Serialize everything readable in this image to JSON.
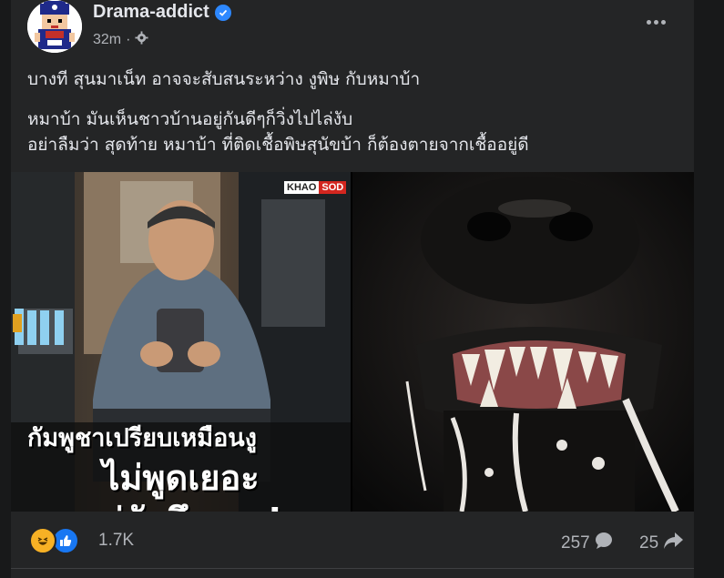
{
  "post": {
    "author": "Drama-addict",
    "time": "32m",
    "text_line1": "บางที สุนมาเน็ท อาจจะสับสนระหว่าง งูพิษ กับหมาบ้า",
    "text_line2": "หมาบ้า มันเห็นชาวบ้านอยู่กันดีๆก็วิ่งไปไล่งับ",
    "text_line3": "อย่าลืมว่า สุดท้าย หมาบ้า ที่ติดเชื้อพิษสุนัขบ้า ก็ต้องตายจากเชื้ออยู่ดี"
  },
  "image": {
    "watermark_a": "KHAO",
    "watermark_b": "SOD",
    "caption_line1": "กัมพูชาเปรียบเหมือนงู",
    "caption_line2": "ไม่พูดเยอะ",
    "caption_line3": "แต่กัดถึงตาย!"
  },
  "stats": {
    "reaction_count": "1.7K",
    "comment_count": "257",
    "share_count": "25"
  },
  "icons": {
    "verified": "verified-badge-icon",
    "privacy": "gear-icon",
    "more": "more-options-icon",
    "haha": "haha-reaction-icon",
    "like": "like-reaction-icon",
    "comment": "comment-icon",
    "share": "share-icon"
  },
  "colors": {
    "background": "#18191a",
    "card": "#242526",
    "accent": "#2d88ff",
    "caption_red": "#d3261f"
  }
}
